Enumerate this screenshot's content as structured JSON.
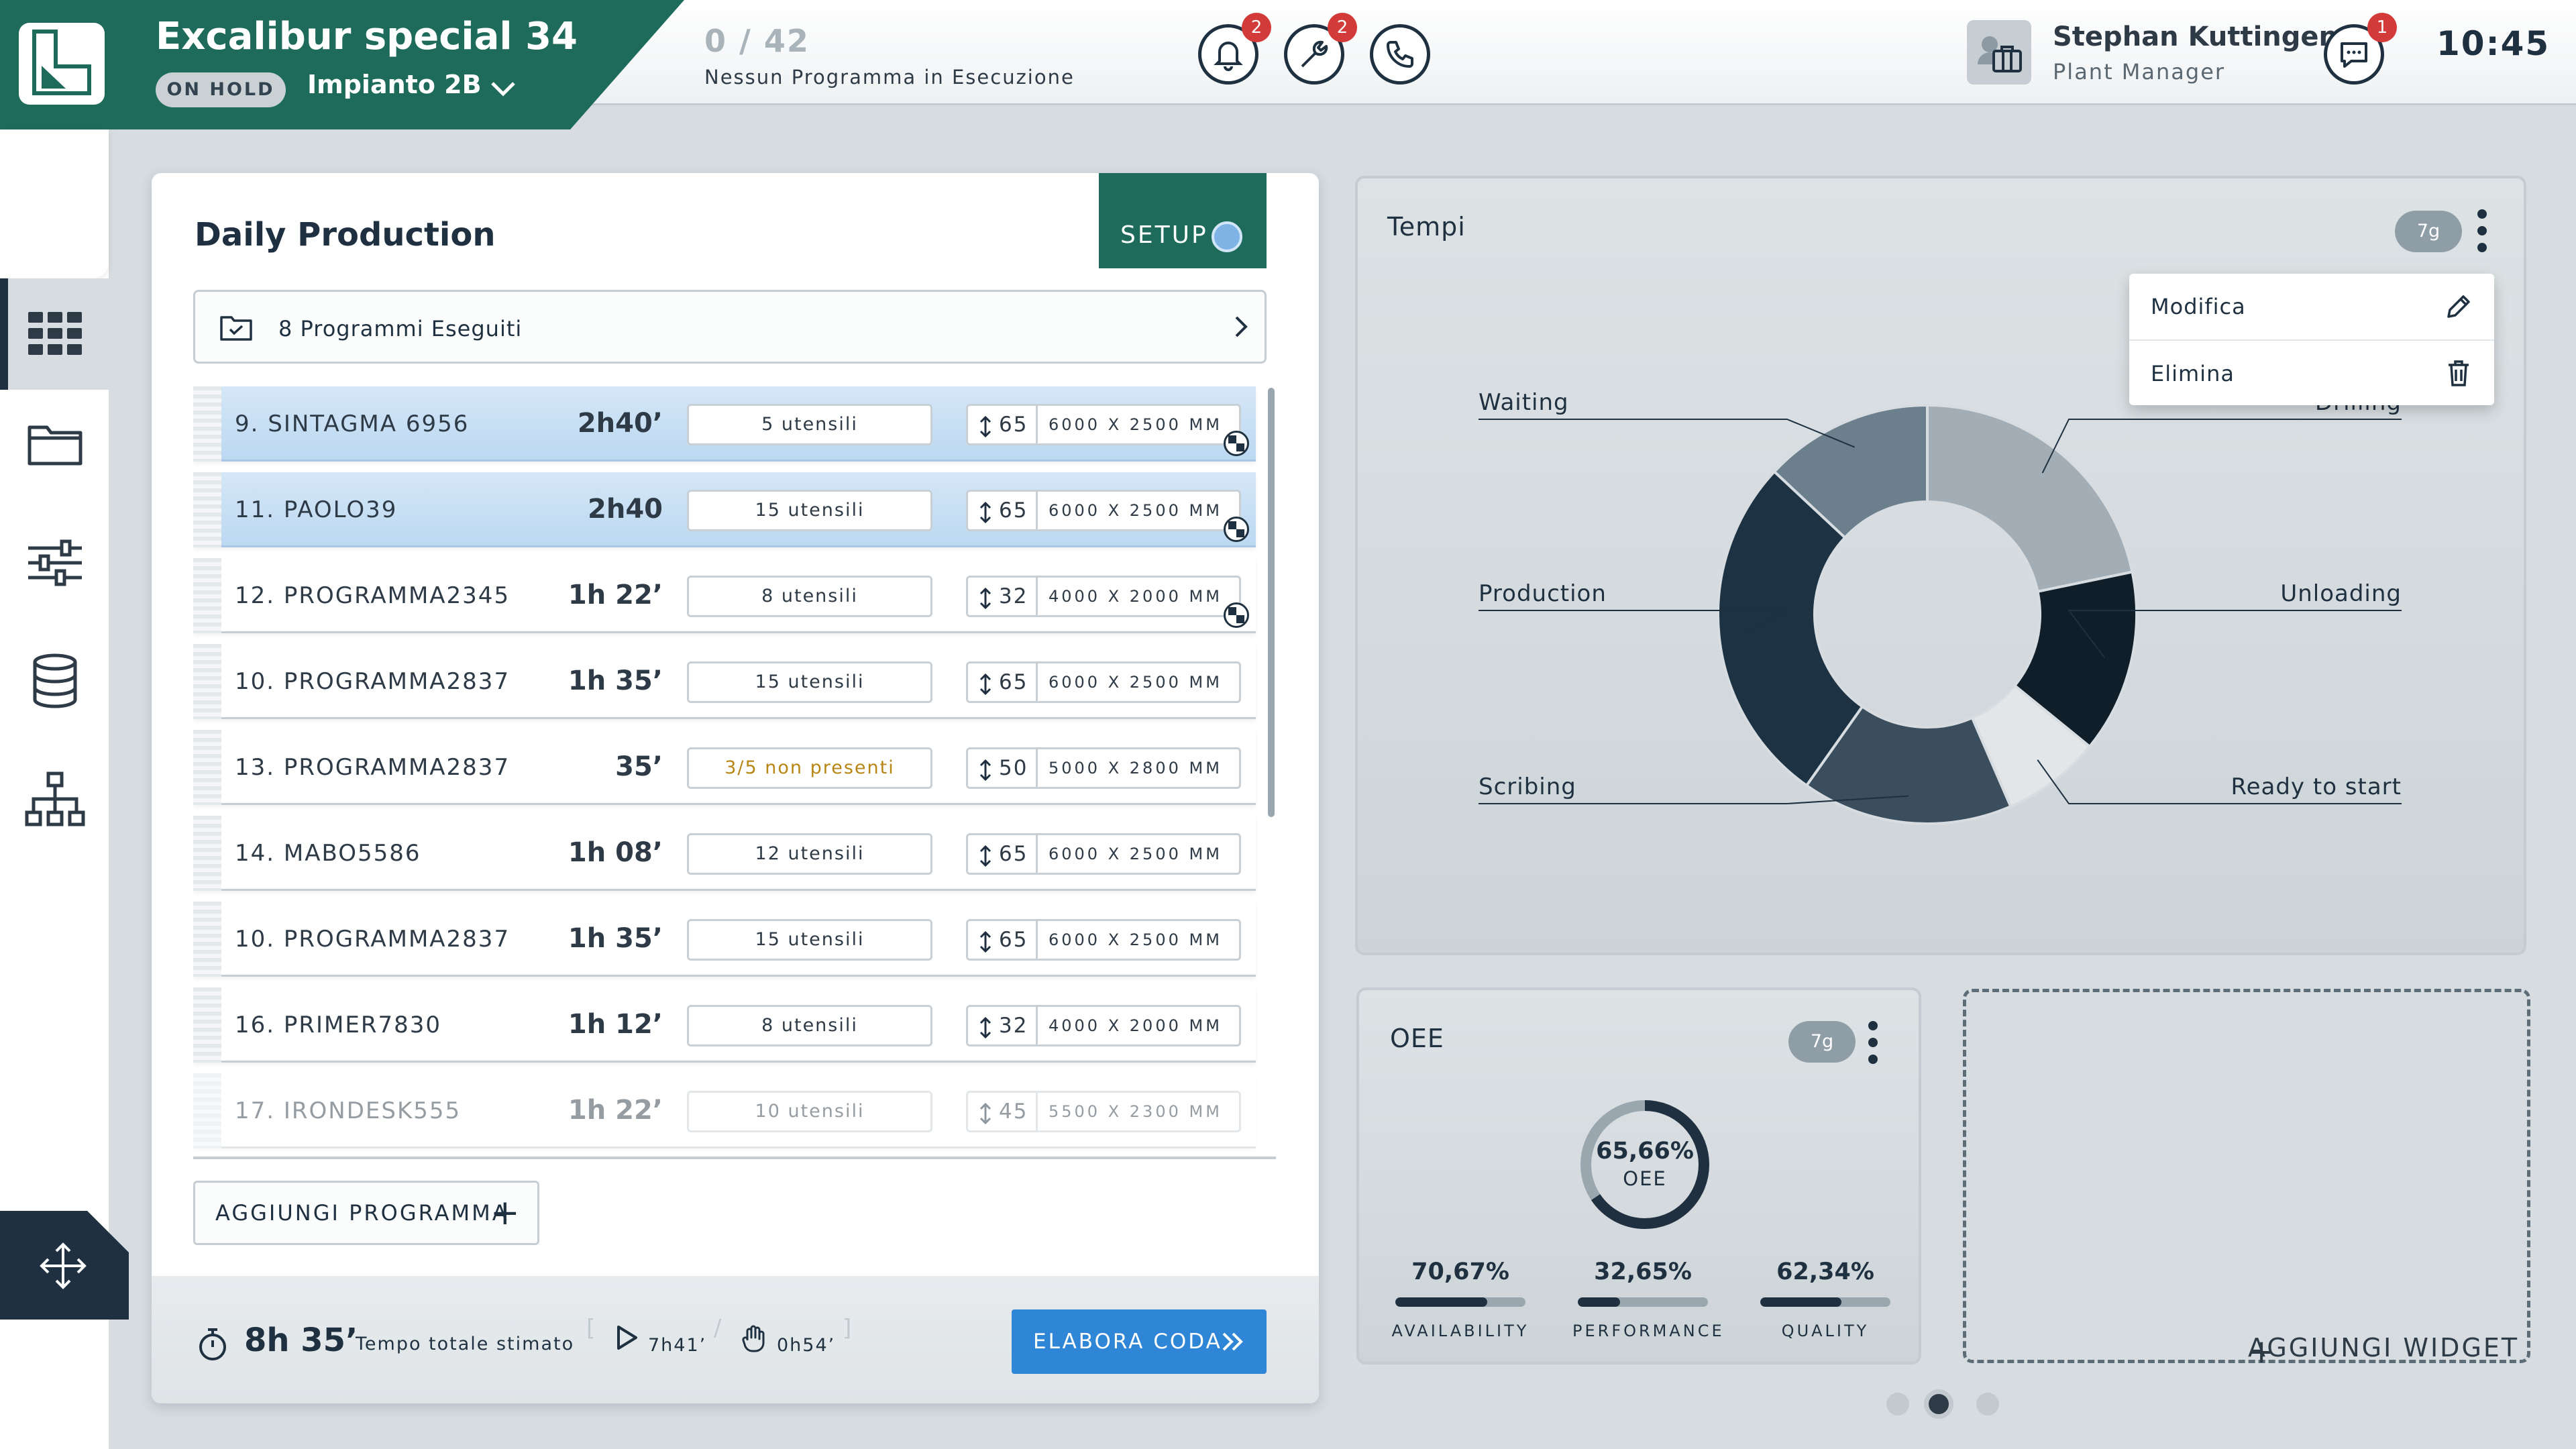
{
  "header": {
    "machine_name": "Excalibur special 34",
    "status": "ON HOLD",
    "plant": "Impianto 2B",
    "program_count": "0 / 42",
    "program_status": "Nessun Programma in Esecuzione",
    "notifications_badge": "2",
    "tools_badge": "2",
    "messages_badge": "1",
    "user_name": "Stephan Kuttingen",
    "user_role": "Plant Manager",
    "clock": "10:45"
  },
  "sidebar": {
    "items": [
      {
        "name": "dashboard-icon"
      },
      {
        "name": "folder-icon"
      },
      {
        "name": "sliders-icon"
      },
      {
        "name": "database-icon"
      },
      {
        "name": "hierarchy-icon"
      },
      {
        "name": "move-icon"
      }
    ]
  },
  "daily_production": {
    "title": "Daily Production",
    "setup_label": "SETUP",
    "executed_label": "8 Programmi Eseguiti",
    "programs": [
      {
        "name": "9. SINTAGMA 6956",
        "time": "2h40’",
        "tools": "5 utensili",
        "qty": "65",
        "dims": "6000 X 2500 MM",
        "state": "selected",
        "flag": true
      },
      {
        "name": "11. PAOLO39",
        "time": "2h40",
        "tools": "15 utensili",
        "qty": "65",
        "dims": "6000 X 2500 MM",
        "state": "selected",
        "flag": true
      },
      {
        "name": "12. PROGRAMMA2345",
        "time": "1h 22’",
        "tools": "8 utensili",
        "qty": "32",
        "dims": "4000 X 2000 MM",
        "state": "normal",
        "flag": true
      },
      {
        "name": "10. PROGRAMMA2837",
        "time": "1h 35’",
        "tools": "15 utensili",
        "qty": "65",
        "dims": "6000 X 2500 MM",
        "state": "normal",
        "flag": false
      },
      {
        "name": "13. PROGRAMMA2837",
        "time": "35’",
        "tools": "3/5 non presenti",
        "qty": "50",
        "dims": "5000 X 2800 MM",
        "state": "warn",
        "flag": false
      },
      {
        "name": "14. MABO5586",
        "time": "1h 08’",
        "tools": "12 utensili",
        "qty": "65",
        "dims": "6000 X 2500 MM",
        "state": "normal",
        "flag": false
      },
      {
        "name": "10. PROGRAMMA2837",
        "time": "1h 35’",
        "tools": "15 utensili",
        "qty": "65",
        "dims": "6000 X 2500 MM",
        "state": "normal",
        "flag": false
      },
      {
        "name": "16. PRIMER7830",
        "time": "1h 12’",
        "tools": "8 utensili",
        "qty": "32",
        "dims": "4000 X 2000 MM",
        "state": "normal",
        "flag": false
      },
      {
        "name": "17. IRONDESK555",
        "time": "1h 22’",
        "tools": "10 utensili",
        "qty": "45",
        "dims": "5500 X 2300 MM",
        "state": "dim",
        "flag": false
      }
    ],
    "add_program": "AGGIUNGI PROGRAMMA",
    "total_time": "8h 35’",
    "total_label": "Tempo totale stimato",
    "run_time": "7h41’",
    "manual_time": "0h54’",
    "process_button": "ELABORA CODA"
  },
  "tempi": {
    "title": "Tempi",
    "period": "7g",
    "menu": [
      {
        "label": "Modifica",
        "icon": "pencil-icon"
      },
      {
        "label": "Elimina",
        "icon": "trash-icon"
      }
    ],
    "chart_data": {
      "type": "pie",
      "labels": [
        "Drilling",
        "Unloading",
        "Ready to start",
        "Scribing",
        "Production",
        "Waiting"
      ],
      "values": [
        20,
        13,
        7,
        15,
        25,
        12
      ],
      "colors": [
        "#a3adb5",
        "#0f1e29",
        "#e2e6e9",
        "#3b4e5d",
        "#1d3344",
        "#6c7f8d"
      ]
    }
  },
  "oee": {
    "title": "OEE",
    "period": "7g",
    "value": "65,66%",
    "value_fraction": 0.6566,
    "value_label": "OEE",
    "kpis": [
      {
        "label": "AVAILABILITY",
        "value": "70,67%",
        "fraction": 0.7067
      },
      {
        "label": "PERFORMANCE",
        "value": "32,65%",
        "fraction": 0.3265
      },
      {
        "label": "QUALITY",
        "value": "62,34%",
        "fraction": 0.6234
      }
    ]
  },
  "add_widget": "AGGIUNGI WIDGET",
  "pager": {
    "pages": 3,
    "active": 1
  }
}
